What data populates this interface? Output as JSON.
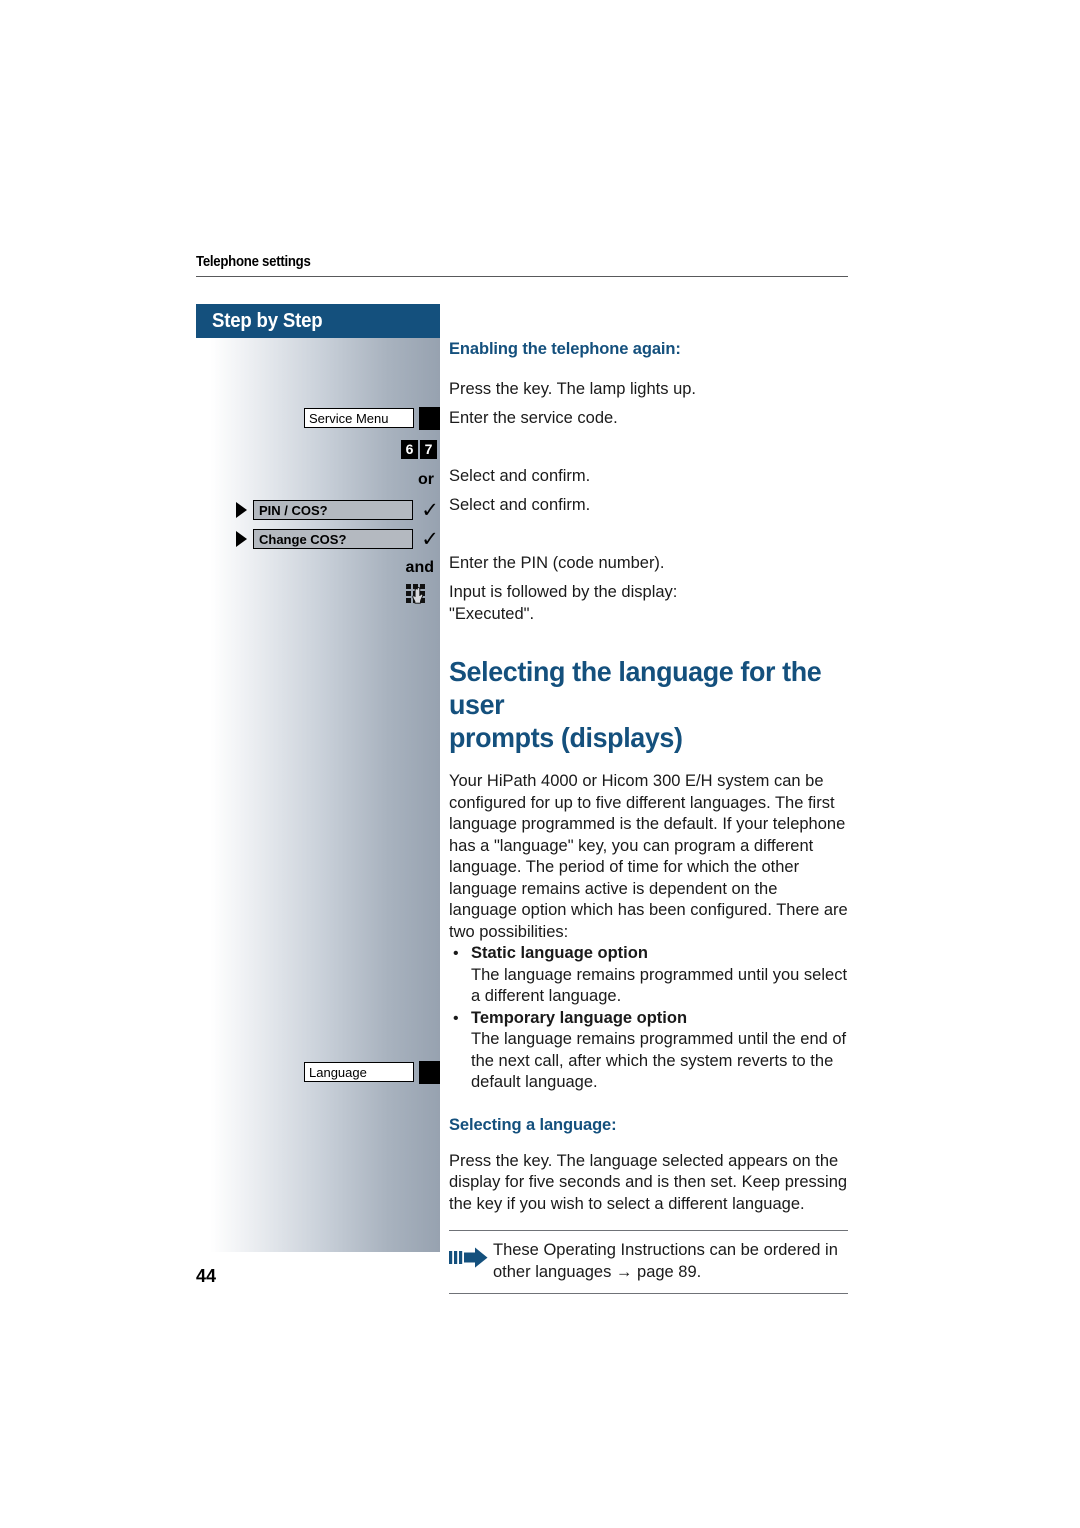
{
  "page": {
    "running_head": "Telephone settings",
    "folio": "44",
    "accent_blue": "#14507d",
    "sidebar_gradient_end": "#97a2b0"
  },
  "sidebar": {
    "header_label": "Step by Step",
    "connectors": {
      "or": "or",
      "and": "and"
    },
    "keys": {
      "service_menu": "Service Menu",
      "language": "Language",
      "service_code_digits": [
        "6",
        "7"
      ]
    },
    "menu_options": [
      {
        "label": "PIN / COS?",
        "check": "✓"
      },
      {
        "label": "Change COS?",
        "check": "✓"
      }
    ],
    "icons": {
      "lamp": "led-lamp",
      "keypad": "keypad-dial-icon",
      "triangle": "select-triangle-icon"
    }
  },
  "content": {
    "section_heading": "Enabling the telephone again:",
    "steps": [
      "Press the key. The lamp lights up.",
      "Enter the service code.",
      "Select and confirm.",
      "Select and confirm.",
      "Enter the PIN (code number)."
    ],
    "result_note_line1": "Input is followed by the display:",
    "result_note_line2": "\"Executed\".",
    "main_heading_line1": "Selecting the language for the user",
    "main_heading_line2": "prompts (displays)",
    "intro_paragraph": "Your HiPath 4000 or Hicom 300 E/H system can be configured for up to five different languages. The first language programmed is the default. If your telephone has a \"language\" key, you can program a different language. The period of time for which the other language remains active is dependent on the language option which has been configured. There are two possibilities:",
    "bullets": [
      {
        "marker": "•",
        "title": "Static language option",
        "text": "The language remains programmed until you select a different language."
      },
      {
        "marker": "•",
        "title": "Temporary language option",
        "text": "The language remains programmed until the end of the next call, after which the system reverts to the default language."
      }
    ],
    "select_heading": "Selecting a language:",
    "select_paragraph": "Press the key. The language selected appears on the display for five seconds and is then set. Keep pressing the key if you wish to select a different language.",
    "note_box": {
      "icon": "arrow-reference-icon",
      "text": "These Operating Instructions can be ordered in other languages → page 89."
    }
  }
}
